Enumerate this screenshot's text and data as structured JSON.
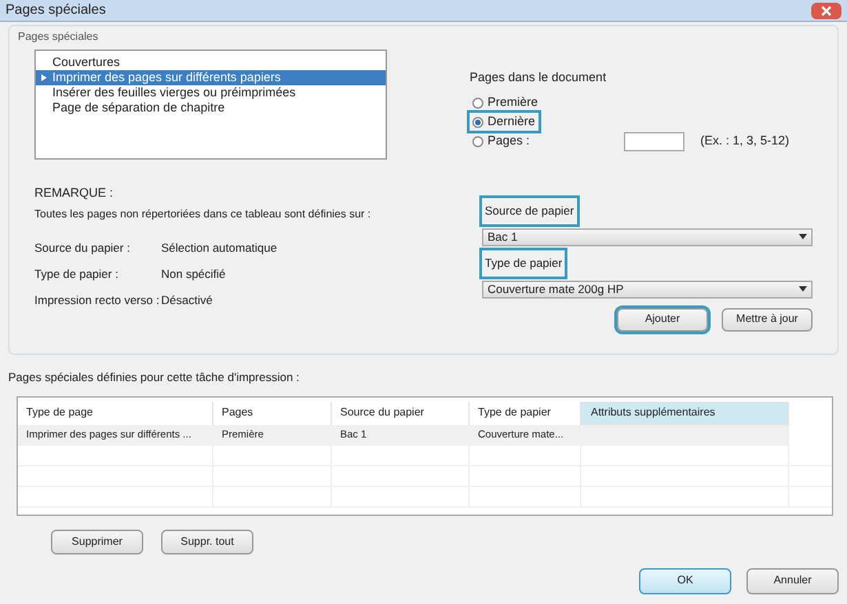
{
  "window": {
    "title": "Pages spéciales"
  },
  "group": {
    "title": "Pages spéciales"
  },
  "page_types": [
    {
      "label": "Couvertures",
      "selected": false
    },
    {
      "label": "Imprimer des pages sur différents papiers",
      "selected": true
    },
    {
      "label": "Insérer des feuilles vierges ou préimprimées",
      "selected": false
    },
    {
      "label": "Page de séparation de chapitre",
      "selected": false
    }
  ],
  "pages_in_document": {
    "title": "Pages dans le document",
    "options": [
      {
        "label": "Première",
        "selected": false,
        "callout": false
      },
      {
        "label": "Dernière",
        "selected": true,
        "callout": true
      },
      {
        "label": "Pages :",
        "selected": false,
        "callout": false
      }
    ],
    "hint": "(Ex. : 1, 3, 5-12)"
  },
  "note": {
    "title": "REMARQUE :",
    "text": "Toutes les pages non répertoriées dans ce tableau sont définies sur :",
    "rows": [
      {
        "label": "Source du papier :",
        "value": "Sélection automatique"
      },
      {
        "label": "Type de papier :",
        "value": "Non spécifié"
      },
      {
        "label": "Impression recto verso :",
        "value": "Désactivé"
      }
    ]
  },
  "paper_source": {
    "label": "Source de papier",
    "callout": true,
    "value": "Bac 1"
  },
  "paper_type": {
    "label": "Type de papier",
    "callout": true,
    "value": "Couverture mate 200g HP"
  },
  "actions": [
    {
      "label": "Ajouter",
      "callout": true
    },
    {
      "label": "Mettre à jour",
      "callout": false
    }
  ],
  "table": {
    "caption": "Pages spéciales définies pour cette tâche d'impression :",
    "columns": [
      {
        "label": "Type de page",
        "selected": false
      },
      {
        "label": "Pages",
        "selected": false
      },
      {
        "label": "Source du papier",
        "selected": false
      },
      {
        "label": "Type de papier",
        "selected": false
      },
      {
        "label": "Attributs supplémentaires",
        "selected": true
      }
    ],
    "rows": [
      [
        "Imprimer des pages sur différents ...",
        "Première",
        "Bac 1",
        "Couverture mate..."
      ]
    ]
  },
  "table_buttons": [
    "Supprimer",
    "Suppr. tout"
  ],
  "dialog_buttons": [
    {
      "label": "OK",
      "default": true
    },
    {
      "label": "Annuler",
      "default": false
    }
  ]
}
